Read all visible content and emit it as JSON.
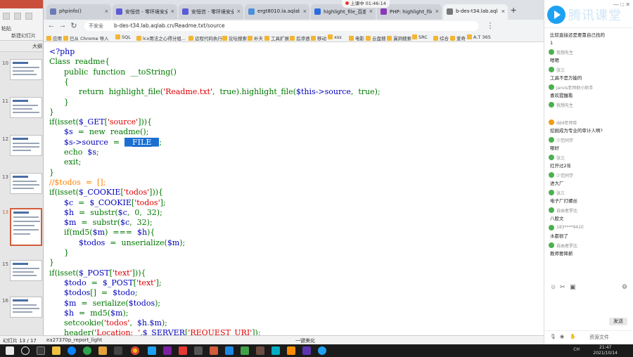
{
  "ppt": {
    "status_slide": "幻灯片 13 / 17",
    "status_theme": "ea27370p_report_light",
    "status_center": "一键美化",
    "status_zoom": "",
    "ribbon_labels": [
      "粘贴",
      "新建幻灯片",
      "版式"
    ],
    "toolbar_label": "大纲",
    "slide_numbers": [
      "10",
      "11",
      "12",
      "13",
      "14",
      "15",
      "16"
    ]
  },
  "browser": {
    "tabs": [
      {
        "title": "phpinfo()",
        "color": "#6b7bb5"
      },
      {
        "title": "安恒信 - 零环境安全社区",
        "color": "#5b5bd6"
      },
      {
        "title": "安恒信 - 零环境安全社区",
        "color": "#5b5bd6"
      },
      {
        "title": "ergt8010.ia.aqlab.cn/u",
        "color": "#4a90d9"
      },
      {
        "title": "highlight_file_百度搜索",
        "color": "#2d6cdf"
      },
      {
        "title": "PHP: highlight_file() 函数",
        "color": "#8a3ab9"
      },
      {
        "title": "b-des-t34.lab.aqlab.cn",
        "color": "#777777"
      }
    ],
    "security_label": "不安全",
    "url": "b-des-t34.lab.aqlab.cn/Readme.txt/source",
    "bookmarks": [
      "应用",
      "已从 Chrome 导入",
      "SQL",
      "lcx用法之心得分组...",
      "远程代码执行",
      "论坛搜索",
      "补天",
      "工具扩展",
      "后渗透",
      "移动",
      "xss",
      "电影",
      "云盘搜",
      "漏洞搜索",
      "SRC",
      "综合",
      "爱奇",
      "A.T 365"
    ],
    "live_pill": "上课中 01:46:14"
  },
  "code": {
    "lines": [
      [
        {
          "t": "<?php",
          "c": ""
        }
      ],
      [
        {
          "t": "Class  readme{",
          "c": "k"
        }
      ],
      [
        {
          "t": "      public  function  __toString()",
          "c": "k"
        }
      ],
      [
        {
          "t": "      {",
          "c": "k"
        }
      ],
      [
        {
          "t": "            return  highlight_file(",
          "c": "k"
        },
        {
          "t": "'Readme.txt'",
          "c": "s"
        },
        {
          "t": ",  true).highlight_file(",
          "c": "k"
        },
        {
          "t": "$this->source",
          "c": ""
        },
        {
          "t": ",  true);",
          "c": "k"
        }
      ],
      [
        {
          "t": "      }",
          "c": "k"
        }
      ],
      [
        {
          "t": "}",
          "c": "k"
        }
      ],
      [
        {
          "t": "if(isset(",
          "c": "k"
        },
        {
          "t": "$_GET",
          "c": ""
        },
        {
          "t": "[",
          "c": "k"
        },
        {
          "t": "'source'",
          "c": "s"
        },
        {
          "t": "])){",
          "c": "k"
        }
      ],
      [
        {
          "t": "      $s",
          "c": ""
        },
        {
          "t": "  =  new  readme();",
          "c": "k"
        }
      ],
      [
        {
          "t": "      $s->source",
          "c": ""
        },
        {
          "t": "  =  ",
          "c": "k"
        },
        {
          "t": "__FILE__",
          "c": "hl"
        },
        {
          "t": ";",
          "c": "k"
        }
      ],
      [
        {
          "t": "      echo  ",
          "c": "k"
        },
        {
          "t": "$s",
          "c": ""
        },
        {
          "t": ";",
          "c": "k"
        }
      ],
      [
        {
          "t": "      exit;",
          "c": "k"
        }
      ],
      [
        {
          "t": "}",
          "c": "k"
        }
      ],
      [
        {
          "t": "//$todos  =  [];",
          "c": "c"
        }
      ],
      [
        {
          "t": "if(isset(",
          "c": "k"
        },
        {
          "t": "$_COOKIE",
          "c": ""
        },
        {
          "t": "[",
          "c": "k"
        },
        {
          "t": "'todos'",
          "c": "s"
        },
        {
          "t": "])){",
          "c": "k"
        }
      ],
      [
        {
          "t": "      $c",
          "c": ""
        },
        {
          "t": "  =  ",
          "c": "k"
        },
        {
          "t": "$_COOKIE",
          "c": ""
        },
        {
          "t": "[",
          "c": "k"
        },
        {
          "t": "'todos'",
          "c": "s"
        },
        {
          "t": "];",
          "c": "k"
        }
      ],
      [
        {
          "t": "      $h",
          "c": ""
        },
        {
          "t": "  =  substr(",
          "c": "k"
        },
        {
          "t": "$c",
          "c": ""
        },
        {
          "t": ",  0,  32);",
          "c": "k"
        }
      ],
      [
        {
          "t": "      $m",
          "c": ""
        },
        {
          "t": "  =  substr(",
          "c": "k"
        },
        {
          "t": "$c",
          "c": ""
        },
        {
          "t": ",  32);",
          "c": "k"
        }
      ],
      [
        {
          "t": "      if(md5(",
          "c": "k"
        },
        {
          "t": "$m",
          "c": ""
        },
        {
          "t": ")  ===  ",
          "c": "k"
        },
        {
          "t": "$h",
          "c": ""
        },
        {
          "t": "){",
          "c": "k"
        }
      ],
      [
        {
          "t": "            $todos",
          "c": ""
        },
        {
          "t": "  =  unserialize(",
          "c": "k"
        },
        {
          "t": "$m",
          "c": ""
        },
        {
          "t": ");",
          "c": "k"
        }
      ],
      [
        {
          "t": "      }",
          "c": "k"
        }
      ],
      [
        {
          "t": "}",
          "c": "k"
        }
      ],
      [
        {
          "t": "if(isset(",
          "c": "k"
        },
        {
          "t": "$_POST",
          "c": ""
        },
        {
          "t": "[",
          "c": "k"
        },
        {
          "t": "'text'",
          "c": "s"
        },
        {
          "t": "])){",
          "c": "k"
        }
      ],
      [
        {
          "t": "      $todo",
          "c": ""
        },
        {
          "t": "  =  ",
          "c": "k"
        },
        {
          "t": "$_POST",
          "c": ""
        },
        {
          "t": "[",
          "c": "k"
        },
        {
          "t": "'text'",
          "c": "s"
        },
        {
          "t": "];",
          "c": "k"
        }
      ],
      [
        {
          "t": "      $todos",
          "c": ""
        },
        {
          "t": "[]  =  ",
          "c": "k"
        },
        {
          "t": "$todo",
          "c": ""
        },
        {
          "t": ";",
          "c": "k"
        }
      ],
      [
        {
          "t": "      $m",
          "c": ""
        },
        {
          "t": "  =  serialize(",
          "c": "k"
        },
        {
          "t": "$todos",
          "c": ""
        },
        {
          "t": ");",
          "c": "k"
        }
      ],
      [
        {
          "t": "      $h",
          "c": ""
        },
        {
          "t": "  =  md5(",
          "c": "k"
        },
        {
          "t": "$m",
          "c": ""
        },
        {
          "t": ");",
          "c": "k"
        }
      ],
      [
        {
          "t": "      setcookie(",
          "c": "k"
        },
        {
          "t": "'todos'",
          "c": "s"
        },
        {
          "t": ",  ",
          "c": "k"
        },
        {
          "t": "$h",
          "c": ""
        },
        {
          "t": ".",
          "c": "k"
        },
        {
          "t": "$m",
          "c": ""
        },
        {
          "t": ");",
          "c": "k"
        }
      ],
      [
        {
          "t": "      header(",
          "c": "k"
        },
        {
          "t": "'Location:  '",
          "c": "s"
        },
        {
          "t": ".",
          "c": "k"
        },
        {
          "t": "$_SERVER",
          "c": ""
        },
        {
          "t": "[",
          "c": "k"
        },
        {
          "t": "'REQUEST_URI'",
          "c": "s"
        },
        {
          "t": "]);",
          "c": "k"
        }
      ]
    ]
  },
  "chat": {
    "logo_text": "腾讯课堂",
    "messages": [
      {
        "name": "",
        "text": "比较直接还是要靠自己找的",
        "avatar": "g"
      },
      {
        "name": "",
        "text": "1",
        "avatar": "o"
      },
      {
        "name": "我想先生",
        "text": "嗯嗯",
        "avatar": "g"
      },
      {
        "name": "张三",
        "text": "工具不是万能的",
        "avatar": "g"
      },
      {
        "name": "Jarvis老师助小助手",
        "text": "喜欢提醒看",
        "avatar": "g"
      },
      {
        "name": "我想先生",
        "text": "",
        "avatar": "g"
      },
      {
        "name": "ddd老师库",
        "text": "挖掘成为专业的审计人啊?",
        "avatar": "o"
      },
      {
        "name": "少范同学",
        "text": "哪好",
        "avatar": "g"
      },
      {
        "name": "张三",
        "text": "红开过2年",
        "avatar": "g"
      },
      {
        "name": "少范同学",
        "text": "进大厂",
        "avatar": "g"
      },
      {
        "name": "张三",
        "text": "电子厂打螺丝",
        "avatar": "g"
      },
      {
        "name": "自由者罗比",
        "text": "八股文",
        "avatar": "g"
      },
      {
        "name": "183****9410",
        "text": "水都很了",
        "avatar": "g"
      },
      {
        "name": "自由者罗比",
        "text": "教师要降薪",
        "avatar": "g"
      }
    ],
    "send_label": "发送",
    "bottom_label": "资源文件"
  },
  "taskbar": {
    "time": "21:47",
    "date": "2021/10/14",
    "lang": "CH"
  }
}
